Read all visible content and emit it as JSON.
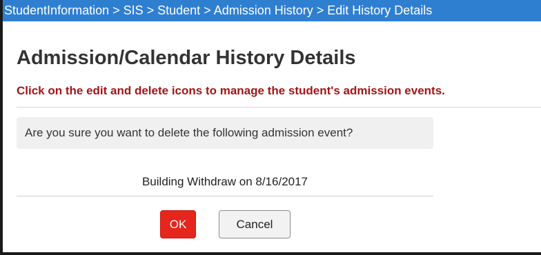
{
  "breadcrumb": {
    "text": "StudentInformation > SIS > Student > Admission History > Edit History Details"
  },
  "page": {
    "title": "Admission/Calendar History Details",
    "instructions": "Click on the edit and delete icons to manage the student's admission events."
  },
  "dialog": {
    "prompt": "Are you sure you want to delete the following admission event?",
    "event": "Building Withdraw on 8/16/2017",
    "ok_label": "OK",
    "cancel_label": "Cancel"
  },
  "colors": {
    "breadcrumb_bg": "#2f7fd1",
    "instructions_text": "#a31515",
    "ok_button": "#e4261c"
  }
}
